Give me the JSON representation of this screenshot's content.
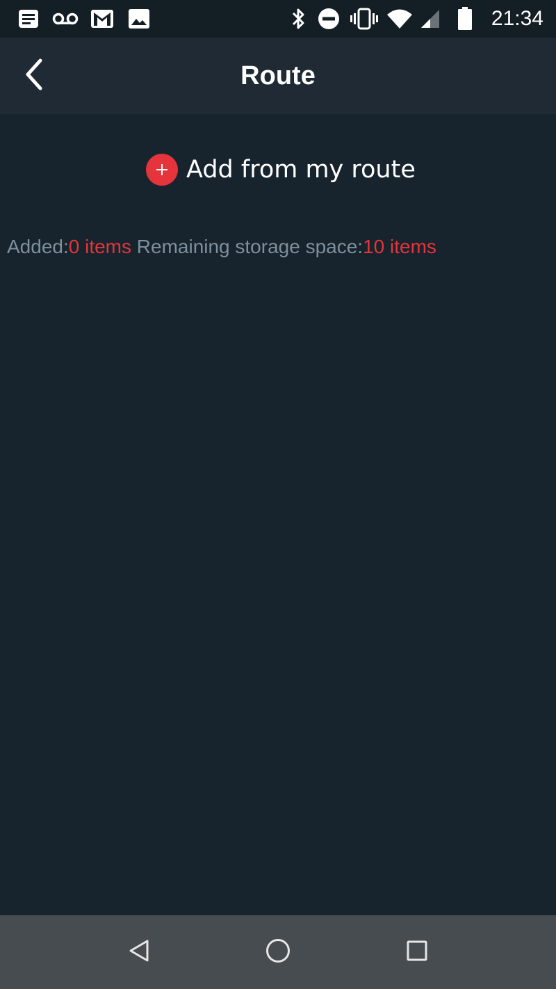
{
  "status_bar": {
    "time": "21:34",
    "icons": [
      "notes-icon",
      "voicemail-icon",
      "gmail-icon",
      "image-icon",
      "bluetooth-icon",
      "do-not-disturb-icon",
      "vibrate-icon",
      "wifi-icon",
      "signal-icon",
      "battery-icon"
    ]
  },
  "header": {
    "title": "Route",
    "back_icon": "back-arrow-icon"
  },
  "main": {
    "add_button_label": "Add from my route",
    "add_icon": "plus-circle-icon",
    "added_label": "Added:",
    "added_value": "0 items",
    "remaining_label": " Remaining storage space:",
    "remaining_value": "10 items"
  },
  "nav_bar": {
    "back": "nav-back-icon",
    "home": "nav-home-icon",
    "recents": "nav-recents-icon"
  },
  "colors": {
    "background": "#17242d",
    "app_bar": "#1f2a34",
    "accent_red": "#e5343b",
    "muted_text": "#7e909d",
    "nav_bar": "#474c51"
  }
}
